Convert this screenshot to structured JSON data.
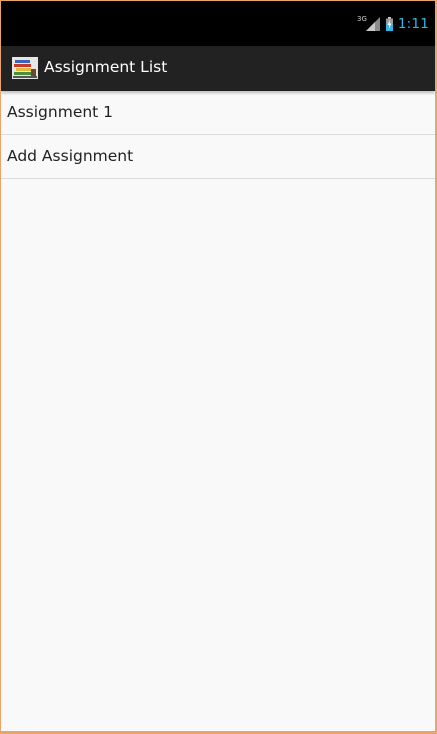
{
  "status_bar": {
    "network_type": "3G",
    "signal_icon": "signal-icon",
    "battery_icon": "battery-icon",
    "time": "1:11"
  },
  "action_bar": {
    "app_icon": "books-icon",
    "title": "Assignment List"
  },
  "list": {
    "items": [
      {
        "label": "Assignment 1"
      },
      {
        "label": "Add Assignment"
      }
    ]
  },
  "colors": {
    "status_bar_bg": "#000000",
    "clock_color": "#33b5e5",
    "action_bar_bg": "#222222",
    "list_bg": "#f9f9f9",
    "frame": "#e8a46a"
  }
}
